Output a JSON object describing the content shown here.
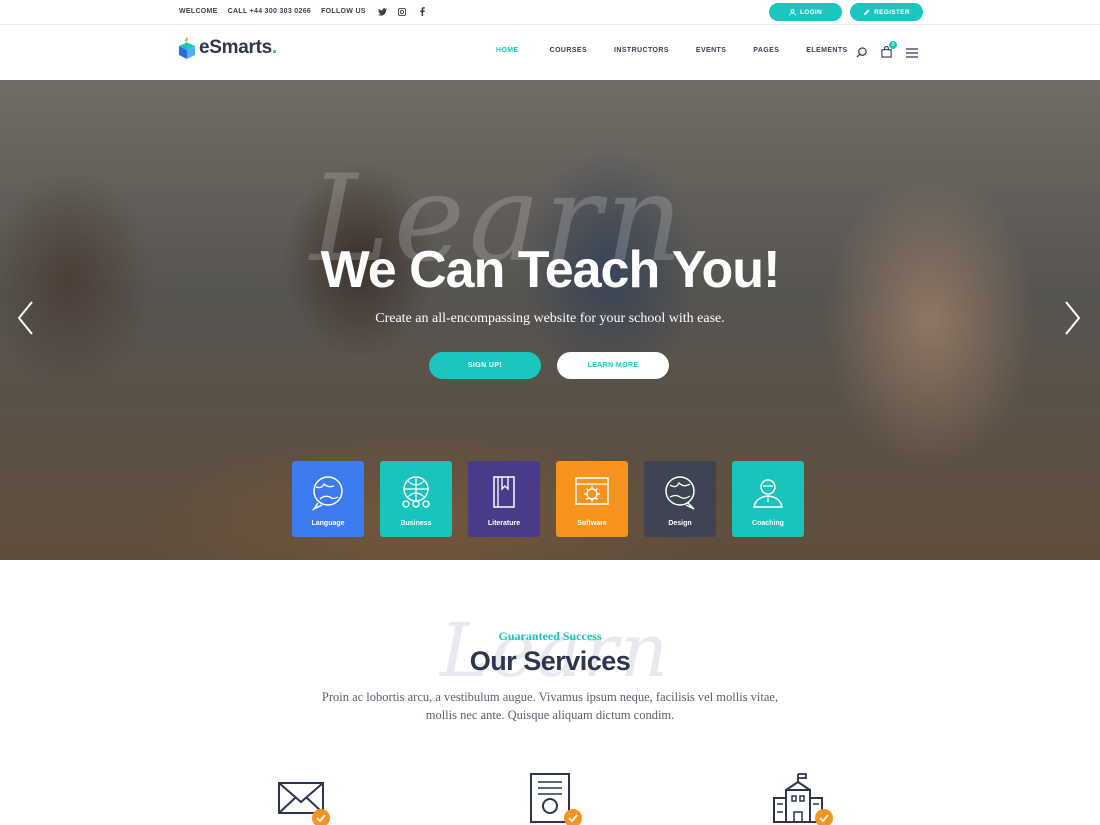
{
  "topbar": {
    "welcome": "WELCOME",
    "call": "CALL +44 300 303 0266",
    "follow": "FOLLOW US",
    "social_icons": [
      "twitter-icon",
      "instagram-icon",
      "facebook-icon"
    ],
    "login": "LOGIN",
    "register": "REGISTER"
  },
  "header": {
    "logo": "eSmarts",
    "logo_dot": ".",
    "nav": [
      "HOME",
      "COURSES",
      "INSTRUCTORS",
      "EVENTS",
      "PAGES",
      "ELEMENTS"
    ],
    "active_nav": "HOME",
    "cart_count": "0"
  },
  "hero": {
    "script_word": "Learn",
    "title": "We Can Teach You!",
    "subtitle": "Create an all-encompassing website for your school with ease.",
    "signup": "SIGN UP!",
    "learn_more": "LEARN MORE",
    "categories": [
      {
        "label": "Language",
        "color": "#3d7bf0",
        "icon": "globe-chat-icon"
      },
      {
        "label": "Business",
        "color": "#18c4bb",
        "icon": "globe-people-icon"
      },
      {
        "label": "Literature",
        "color": "#4a3a8a",
        "icon": "book-icon"
      },
      {
        "label": "Software",
        "color": "#f7941d",
        "icon": "browser-gear-icon"
      },
      {
        "label": "Design",
        "color": "#3e4453",
        "icon": "globe-chat-icon"
      },
      {
        "label": "Coaching",
        "color": "#18c4bb",
        "icon": "teacher-icon"
      }
    ]
  },
  "services": {
    "bg_word": "Learn",
    "tag": "Guaranteed Success",
    "title": "Our Services",
    "desc_line1": "Proin ac lobortis arcu, a vestibulum augue. Vivamus ipsum neque, facilisis vel mollis vitae,",
    "desc_line2": "mollis nec ante. Quisque aliquam dictum condim.",
    "icons": [
      "envelope-icon",
      "certificate-icon",
      "school-icon"
    ]
  },
  "colors": {
    "accent": "#1cc5bd",
    "dark": "#2d3550",
    "badge": "#f7941d"
  }
}
